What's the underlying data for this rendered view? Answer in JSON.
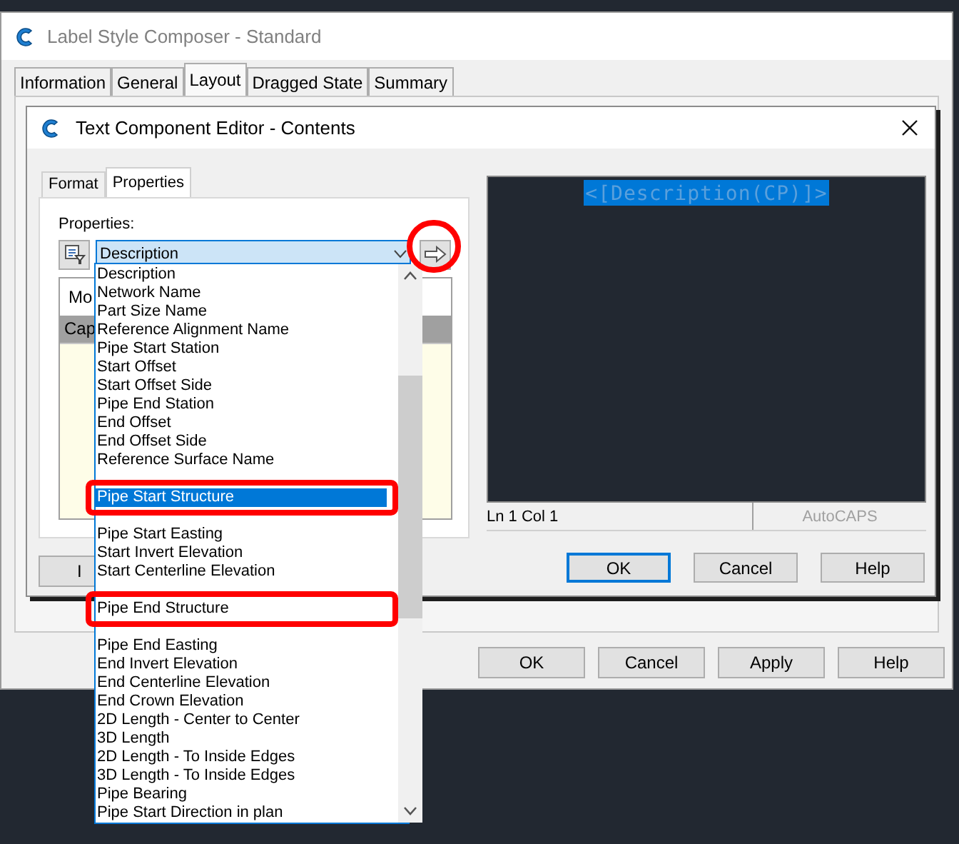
{
  "outer_window": {
    "title": "Label Style Composer - Standard",
    "tabs": [
      {
        "label": "Information",
        "selected": false
      },
      {
        "label": "General",
        "selected": false
      },
      {
        "label": "Layout",
        "selected": true
      },
      {
        "label": "Dragged State",
        "selected": false
      },
      {
        "label": "Summary",
        "selected": false
      }
    ],
    "buttons": [
      "OK",
      "Cancel",
      "Apply",
      "Help"
    ]
  },
  "editor": {
    "title": "Text Component Editor - Contents",
    "tabs": [
      {
        "label": "Format",
        "selected": false
      },
      {
        "label": "Properties",
        "selected": true
      }
    ],
    "properties_label": "Properties:",
    "combo_value": "Description",
    "arrow_button_annotated": true,
    "grid": {
      "heading": "Mo",
      "column_1": "Cap"
    },
    "left_button": "I",
    "preview": {
      "text": "<[Description(CP)]>",
      "position": "Ln 1 Col 1",
      "mode": "AutoCAPS"
    },
    "buttons": [
      {
        "label": "OK",
        "default": true
      },
      {
        "label": "Cancel",
        "default": false
      },
      {
        "label": "Help",
        "default": false
      }
    ]
  },
  "dropdown": {
    "items": [
      {
        "label": "Description",
        "selected": false,
        "annotated": false
      },
      {
        "label": "Network Name",
        "selected": false,
        "annotated": false
      },
      {
        "label": "Part Size Name",
        "selected": false,
        "annotated": false
      },
      {
        "label": "Reference Alignment Name",
        "selected": false,
        "annotated": false
      },
      {
        "label": "Pipe Start Station",
        "selected": false,
        "annotated": false
      },
      {
        "label": "Start Offset",
        "selected": false,
        "annotated": false
      },
      {
        "label": "Start Offset Side",
        "selected": false,
        "annotated": false
      },
      {
        "label": "Pipe End Station",
        "selected": false,
        "annotated": false
      },
      {
        "label": "End Offset",
        "selected": false,
        "annotated": false
      },
      {
        "label": "End Offset Side",
        "selected": false,
        "annotated": false
      },
      {
        "label": "Reference Surface Name",
        "selected": false,
        "annotated": false
      },
      {
        "kind": "covered"
      },
      {
        "label": "Pipe Start Structure",
        "selected": true,
        "annotated": true
      },
      {
        "kind": "covered"
      },
      {
        "label": "Pipe Start Easting",
        "selected": false,
        "annotated": false
      },
      {
        "label": "Start Invert Elevation",
        "selected": false,
        "annotated": false
      },
      {
        "label": "Start Centerline Elevation",
        "selected": false,
        "annotated": false
      },
      {
        "kind": "covered"
      },
      {
        "label": "Pipe End Structure",
        "selected": false,
        "annotated": true
      },
      {
        "kind": "covered"
      },
      {
        "label": "Pipe End Easting",
        "selected": false,
        "annotated": false
      },
      {
        "label": "End Invert Elevation",
        "selected": false,
        "annotated": false
      },
      {
        "label": "End Centerline Elevation",
        "selected": false,
        "annotated": false
      },
      {
        "label": "End Crown Elevation",
        "selected": false,
        "annotated": false
      },
      {
        "label": "2D Length - Center to Center",
        "selected": false,
        "annotated": false
      },
      {
        "label": "3D Length",
        "selected": false,
        "annotated": false
      },
      {
        "label": "2D Length - To Inside Edges",
        "selected": false,
        "annotated": false
      },
      {
        "label": "3D Length - To Inside Edges",
        "selected": false,
        "annotated": false
      },
      {
        "label": "Pipe Bearing",
        "selected": false,
        "annotated": false
      },
      {
        "label": "Pipe Start Direction in plan",
        "selected": false,
        "annotated": false
      }
    ]
  }
}
